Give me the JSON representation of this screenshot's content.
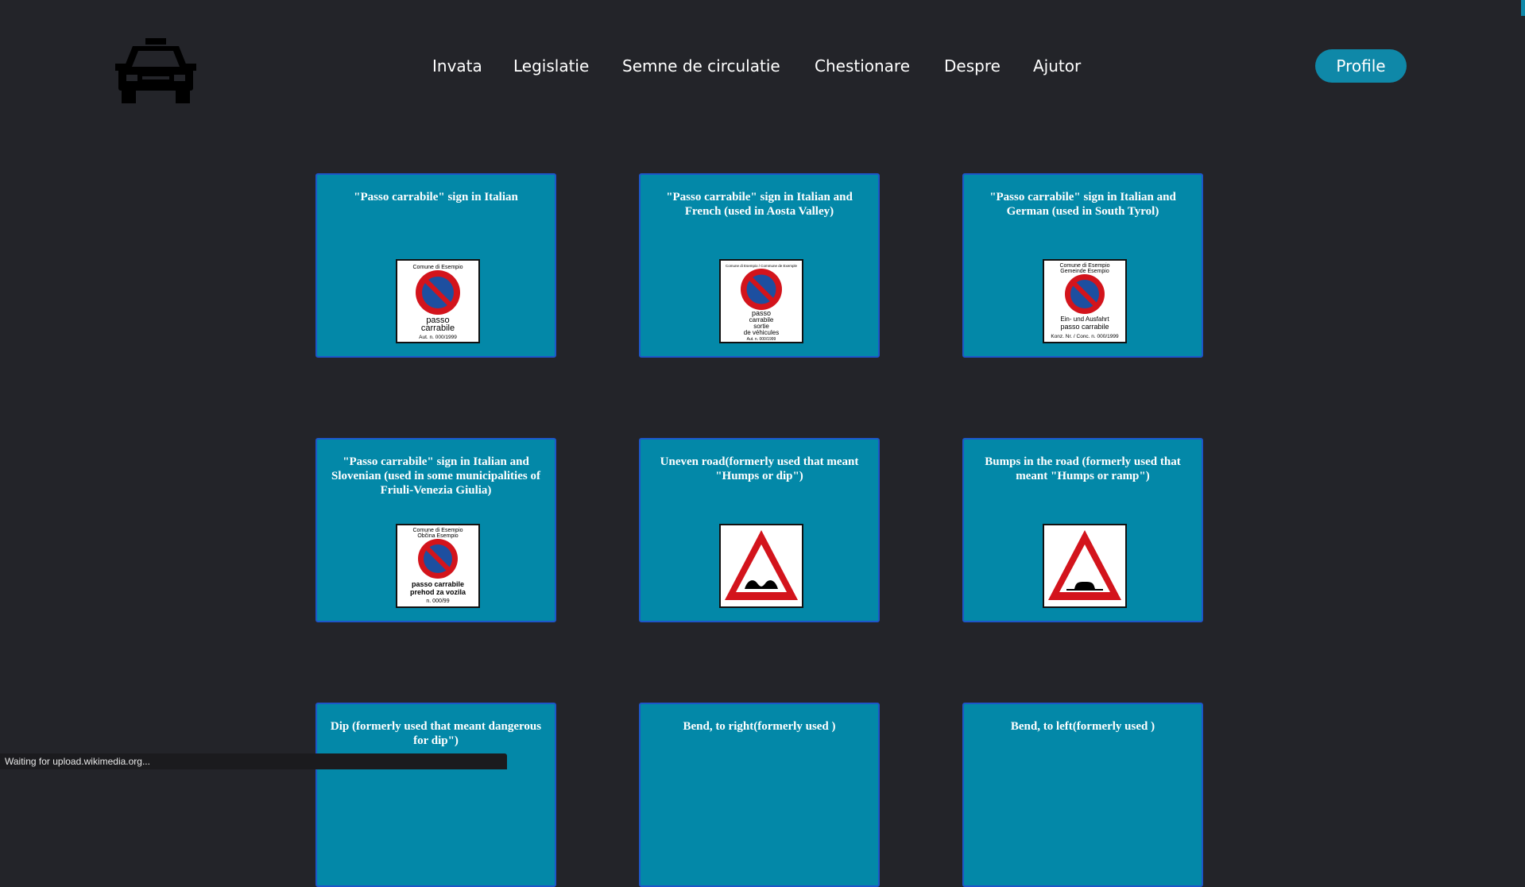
{
  "nav": {
    "items": [
      {
        "label": "Invata"
      },
      {
        "label": "Legislatie"
      },
      {
        "label": "Semne de circulatie"
      },
      {
        "label": "Chestionare"
      },
      {
        "label": "Despre"
      },
      {
        "label": "Ajutor"
      }
    ],
    "profile_label": "Profile"
  },
  "logo_icon": "car-icon",
  "cards": [
    {
      "title": "\"Passo carrabile\" sign in Italian",
      "sign": "no-parking-sign",
      "sign_text": [
        "Comune di Esempio",
        "passo",
        "carrabile",
        "Aut. n. 000/1999"
      ]
    },
    {
      "title": "\"Passo carrabile\" sign in Italian and French (used in Aosta Valley)",
      "sign": "no-parking-sign",
      "sign_text": [
        "Comune di Esempio / Commune de Exemple",
        "passo",
        "carrabile",
        "sortie",
        "de véhicules",
        "Aut. n. 000/1999"
      ]
    },
    {
      "title": "\"Passo carrabile\" sign in Italian and German (used in South Tyrol)",
      "sign": "no-parking-sign",
      "sign_text": [
        "Comune di Esempio",
        "Gemeinde Esempio",
        "Ein- und Ausfahrt",
        "passo carrabile",
        "Konz. Nr. / Conc. n. 000/1999"
      ]
    },
    {
      "title": "\"Passo carrabile\" sign in Italian and Slovenian (used in some municipalities of Friuli-Venezia Giulia)",
      "sign": "no-parking-sign",
      "sign_text": [
        "Comune di Esempio",
        "Občina Esempio",
        "passo carrabile",
        "prehod za vozila",
        "n. 000/99"
      ]
    },
    {
      "title": "Uneven road(formerly used that meant \"Humps or dip\")",
      "sign": "warning-humps-sign",
      "sign_text": []
    },
    {
      "title": "Bumps in the road (formerly used that meant \"Humps or ramp\")",
      "sign": "warning-bump-sign",
      "sign_text": []
    },
    {
      "title": "Dip (formerly used that meant dangerous for dip\")",
      "sign": "",
      "sign_text": []
    },
    {
      "title": "Bend, to right(formerly used )",
      "sign": "",
      "sign_text": []
    },
    {
      "title": "Bend, to left(formerly used )",
      "sign": "",
      "sign_text": []
    }
  ],
  "status_text": "Waiting for upload.wikimedia.org...",
  "colors": {
    "background": "#232429",
    "card": "#0388a8",
    "card_border": "#1e56c8",
    "accent": "#0f88a8"
  }
}
